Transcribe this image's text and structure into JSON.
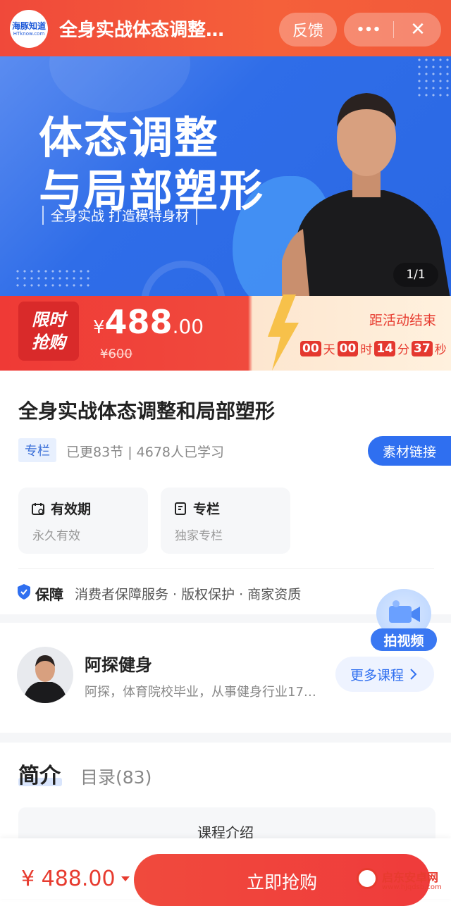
{
  "topbar": {
    "logo_text": "海豚知道",
    "logo_sub": "HTknow.com",
    "title": "全身实战体态调整…",
    "feedback": "反馈",
    "more": "•••",
    "close": "✕"
  },
  "banner": {
    "title_line1": "体态调整",
    "title_line2": "与局部塑形",
    "subtitle": "全身实战  打造模特身材",
    "pager": "1/1"
  },
  "sale": {
    "tag_line1": "限时",
    "tag_line2": "抢购",
    "currency": "¥",
    "price_int": "488",
    "price_dec": ".00",
    "original": "¥600",
    "ends_label": "距活动结束",
    "countdown": [
      {
        "num": "00",
        "unit": "天"
      },
      {
        "num": "00",
        "unit": "时"
      },
      {
        "num": "14",
        "unit": "分"
      },
      {
        "num": "37",
        "unit": "秒"
      }
    ]
  },
  "course": {
    "title": "全身实战体态调整和局部塑形",
    "badge": "专栏",
    "meta": "已更83节 | 4678人已学习",
    "material_btn": "素材链接",
    "cards": [
      {
        "icon": "calendar-icon",
        "title": "有效期",
        "value": "永久有效"
      },
      {
        "icon": "column-icon",
        "title": "专栏",
        "value": "独家专栏"
      }
    ],
    "guarantee_label": "保障",
    "guarantee_items": "消费者保障服务 · 版权保护 · 商家资质"
  },
  "float_camera": {
    "label": "拍视频"
  },
  "teacher": {
    "name": "阿探健身",
    "desc": "阿探，体育院校毕业，从事健身行业17…",
    "more_btn": "更多课程"
  },
  "tabs": {
    "intro": "简介",
    "catalog": "目录(83)"
  },
  "intro_section": {
    "title": "课程介绍"
  },
  "bottom_bar": {
    "price": "¥ 488.00",
    "buy_btn": "立即抢购"
  },
  "watermark": {
    "line1": "启东安卓网",
    "line2": "www.hjqdsb.com"
  },
  "colors": {
    "brand_red": "#ef3a36",
    "brand_blue": "#2f6ff0"
  }
}
